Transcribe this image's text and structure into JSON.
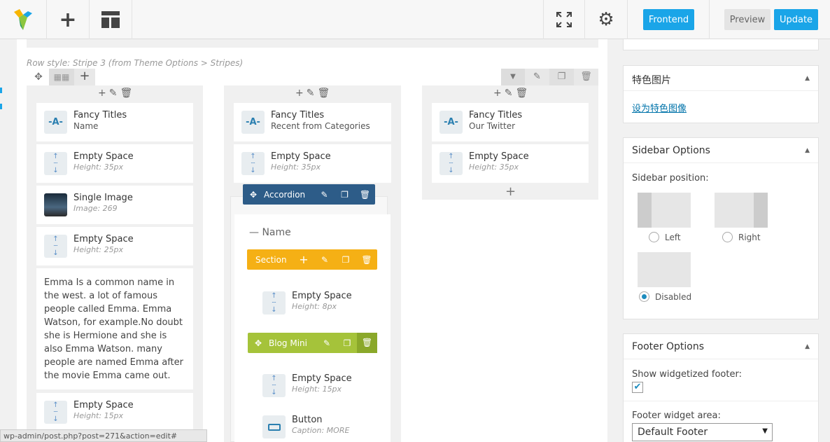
{
  "toolbar": {
    "frontend": "Frontend",
    "preview": "Preview",
    "update": "Update"
  },
  "row": {
    "style_label": "Row style: Stripe 3 (from Theme Options > Stripes)"
  },
  "col1": [
    {
      "title": "Fancy Titles",
      "sub": "Name"
    },
    {
      "title": "Empty Space",
      "sub": "Height: 35px"
    },
    {
      "title": "Single Image",
      "sub": "Image: 269"
    },
    {
      "title": "Empty Space",
      "sub": "Height: 25px"
    },
    {
      "text": "Emma Is a common name in the west. a lot of famous people called Emma. Emma Watson, for example.No doubt she is Hermione and she is also Emma Watson. many people are named Emma after the movie Emma came out."
    },
    {
      "title": "Empty Space",
      "sub": "Height: 15px"
    }
  ],
  "col2": {
    "fancy": {
      "title": "Fancy Titles",
      "sub": "Recent from Categories"
    },
    "empty1": {
      "title": "Empty Space",
      "sub": "Height: 35px"
    },
    "accordion": "Accordion",
    "acc_title": "Name",
    "section": "Section",
    "empty2": {
      "title": "Empty Space",
      "sub": "Height: 8px"
    },
    "blog": "Blog Mini",
    "empty3": {
      "title": "Empty Space",
      "sub": "Height: 15px"
    },
    "button": {
      "title": "Button",
      "sub": "Caption: MORE"
    }
  },
  "col3": [
    {
      "title": "Fancy Titles",
      "sub": "Our Twitter"
    },
    {
      "title": "Empty Space",
      "sub": "Height: 35px"
    }
  ],
  "featured": {
    "title": "特色图片",
    "link": "设为特色图像"
  },
  "sidebar": {
    "title": "Sidebar Options",
    "label": "Sidebar position:",
    "left": "Left",
    "right": "Right",
    "disabled": "Disabled"
  },
  "footer": {
    "title": "Footer Options",
    "show_label": "Show widgetized footer:",
    "area_label": "Footer widget area:",
    "area_value": "Default Footer"
  },
  "status_url": "wp-admin/post.php?post=271&action=edit#",
  "colors": {
    "accent": "#1aa5e8",
    "accordion": "#2d5c88",
    "section": "#f5b015",
    "blog": "#a5c33a"
  }
}
